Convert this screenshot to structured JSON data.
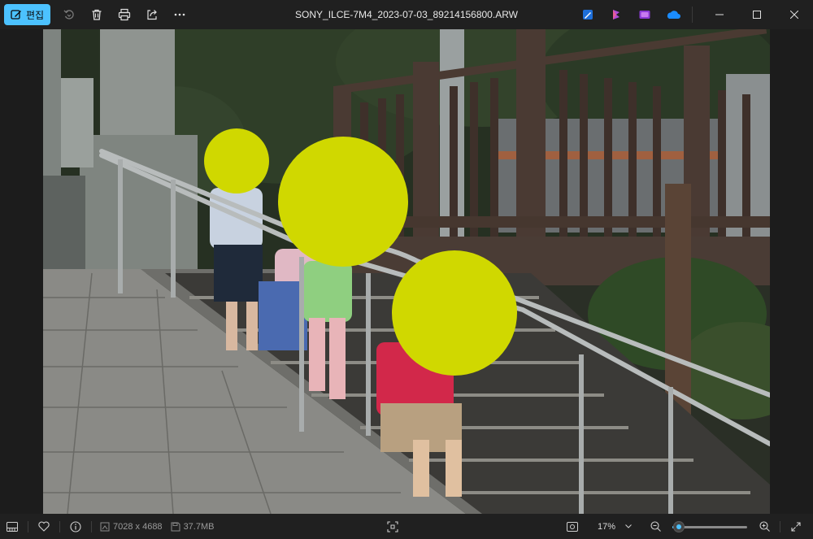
{
  "toolbar": {
    "edit_label": "편집",
    "icons": [
      "rotate-icon",
      "delete-icon",
      "print-icon",
      "share-icon",
      "more-icon"
    ]
  },
  "window": {
    "title": "SONY_ILCE-7M4_2023-07-03_89214156800.ARW"
  },
  "colors": {
    "accent": "#4cc2ff",
    "background": "#202020",
    "blur_circle": "#d0d800"
  },
  "status": {
    "dimensions": "7028 x 4688",
    "file_size": "37.7MB",
    "zoom": "17%",
    "zoom_fraction": 0.17
  }
}
